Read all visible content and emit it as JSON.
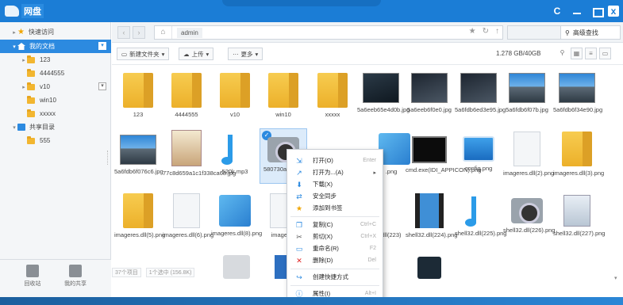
{
  "app": {
    "title": "网盘"
  },
  "window_controls": {
    "refresh": "C",
    "minimize": "",
    "maximize": "",
    "close": "x"
  },
  "sidebar": {
    "items": [
      {
        "label": "快速访问",
        "icon": "star-icon",
        "level": 0,
        "caret": "▸"
      },
      {
        "label": "我的文档",
        "icon": "home-icon",
        "level": 0,
        "caret": "▾",
        "selected": true
      },
      {
        "label": "123",
        "icon": "folder-icon",
        "level": 1,
        "caret": "▸"
      },
      {
        "label": "4444555",
        "icon": "folder-icon",
        "level": 1,
        "caret": ""
      },
      {
        "label": "v10",
        "icon": "folder-icon",
        "level": 1,
        "caret": "▸"
      },
      {
        "label": "win10",
        "icon": "folder-icon",
        "level": 1,
        "caret": ""
      },
      {
        "label": "xxxxx",
        "icon": "folder-icon",
        "level": 1,
        "caret": ""
      },
      {
        "label": "共享目录",
        "icon": "share-folder-icon",
        "level": 0,
        "caret": "▾"
      },
      {
        "label": "555",
        "icon": "folder-icon",
        "level": 1,
        "caret": ""
      }
    ],
    "bottom": {
      "recycle": "回收站",
      "my_share": "我的共享"
    }
  },
  "nav": {
    "back": "‹",
    "forward": "›",
    "path": "admin",
    "search_button": "高级查找"
  },
  "toolbar": {
    "new_folder": "新建文件夹",
    "upload": "上传",
    "more": "更多",
    "storage": "1.278 GB/40GB"
  },
  "files": [
    {
      "name": "123",
      "type": "folder"
    },
    {
      "name": "4444555",
      "type": "folder"
    },
    {
      "name": "v10",
      "type": "folder"
    },
    {
      "name": "win10",
      "type": "folder"
    },
    {
      "name": "xxxxx",
      "type": "folder"
    },
    {
      "name": "5a6eeb65e4d0b.jpg",
      "type": "photo"
    },
    {
      "name": "5a6eeb6f0e0.jpg",
      "type": "photo2"
    },
    {
      "name": "5a6fdb6ed3e95.jpg",
      "type": "photo2"
    },
    {
      "name": "5a6fdb6f07b.jpg",
      "type": "photo3"
    },
    {
      "name": "5a6fdb6f34e90.jpg",
      "type": "photo3"
    },
    {
      "name": "5a6fdb6f076c6.jpg",
      "type": "photo3"
    },
    {
      "name": "77c8d659a1c1f338ca68.jpg",
      "type": "portrait"
    },
    {
      "name": "520k.mp3",
      "type": "music"
    },
    {
      "name": "580730a27b63",
      "type": "camera",
      "selected": true
    },
    {
      "name": ".png",
      "type": "blue-square"
    },
    {
      "name": "cmd.exe(IDI_APPICON).png",
      "type": "cmd"
    },
    {
      "name": "config.png",
      "type": "config"
    },
    {
      "name": "imageres.dll(2).png",
      "type": "doc"
    },
    {
      "name": "imageres.dll(3).png",
      "type": "folder"
    },
    {
      "name": "imageres.dll(5).png",
      "type": "folder"
    },
    {
      "name": "imageres.dll(6).png",
      "type": "doc"
    },
    {
      "name": "imageres.dll(8).png",
      "type": "blue-square"
    },
    {
      "name": "imageres",
      "type": "doc"
    },
    {
      "name": "dll(223)",
      "type": "doc"
    },
    {
      "name": "shell32.dll(224).png",
      "type": "film"
    },
    {
      "name": "shell32.dll(225).png",
      "type": "music"
    },
    {
      "name": "shell32.dll(226).png",
      "type": "camera"
    },
    {
      "name": "shell32.dll(227).png",
      "type": "installer"
    }
  ],
  "status": {
    "count": "37个项目",
    "selected": "1个选中 (156.8K)"
  },
  "context_menu": {
    "items": [
      {
        "label": "打开(O)",
        "icon": "open-icon",
        "key": "Enter"
      },
      {
        "label": "打开为...(A)",
        "icon": "open-as-icon",
        "key": "▸"
      },
      {
        "label": "下载(X)",
        "icon": "download-icon",
        "key": ""
      },
      {
        "label": "安全同步",
        "icon": "sync-icon",
        "key": ""
      },
      {
        "label": "添加到书签",
        "icon": "bookmark-icon",
        "key": ""
      },
      {
        "label": "复制(C)",
        "icon": "copy-icon",
        "key": "Ctrl+C"
      },
      {
        "label": "剪切(X)",
        "icon": "cut-icon",
        "key": "Ctrl+X"
      },
      {
        "label": "重命名(R)",
        "icon": "rename-icon",
        "key": "F2"
      },
      {
        "label": "删除(D)",
        "icon": "delete-icon",
        "key": "Del"
      },
      {
        "label": "创建快捷方式",
        "icon": "shortcut-icon",
        "key": ""
      },
      {
        "label": "属性(I)",
        "icon": "info-icon",
        "key": "Alt+I"
      }
    ]
  },
  "colors": {
    "accent": "#1b7dd6",
    "selected": "#2c8ae0",
    "folder": "#f2b630",
    "danger": "#e02020"
  }
}
